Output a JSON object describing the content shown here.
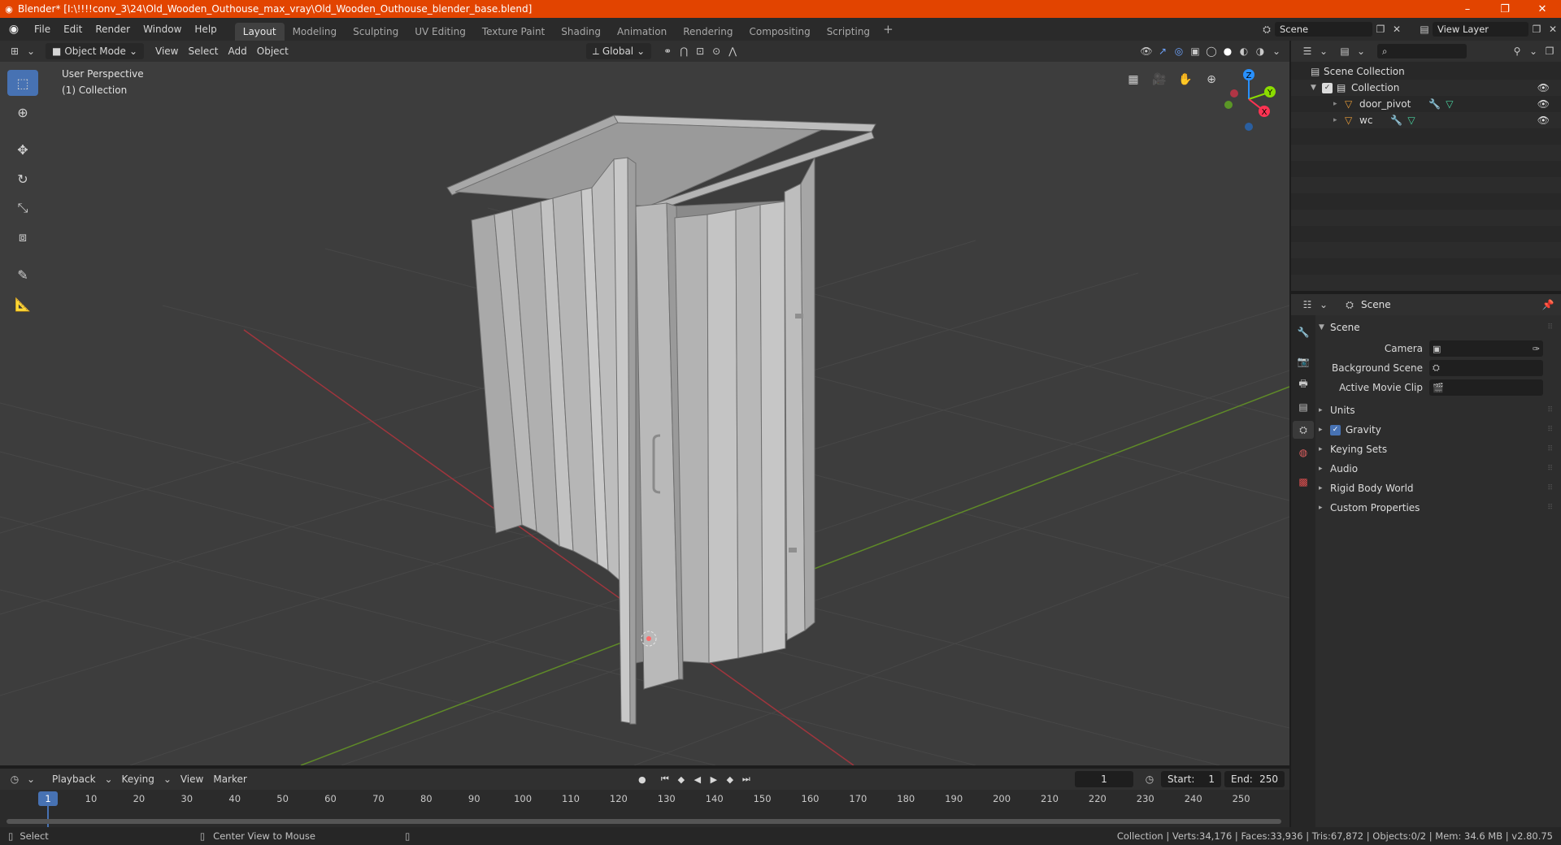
{
  "window": {
    "title": "Blender* [I:\\!!!!conv_3\\24\\Old_Wooden_Outhouse_max_vray\\Old_Wooden_Outhouse_blender_base.blend]",
    "minimize": "–",
    "maximize": "❐",
    "close": "✕"
  },
  "menu": [
    "File",
    "Edit",
    "Render",
    "Window",
    "Help"
  ],
  "workspaces": [
    "Layout",
    "Modeling",
    "Sculpting",
    "UV Editing",
    "Texture Paint",
    "Shading",
    "Animation",
    "Rendering",
    "Compositing",
    "Scripting"
  ],
  "workspace_add": "+",
  "scene_selector": "Scene",
  "view_layer": "View Layer",
  "viewport": {
    "mode": "Object Mode",
    "menus": [
      "View",
      "Select",
      "Add",
      "Object"
    ],
    "transform_orientation": "Global",
    "perspective_label": "User Perspective",
    "collection_label": "(1) Collection",
    "gizmo_axes": {
      "x": "X",
      "y": "Y",
      "z": "Z"
    }
  },
  "timeline": {
    "menus": [
      "Playback",
      "Keying",
      "View",
      "Marker"
    ],
    "current_frame": "1",
    "start_label": "Start:",
    "start": "1",
    "end_label": "End:",
    "end": "250",
    "ruler": [
      "1",
      "10",
      "20",
      "30",
      "40",
      "50",
      "60",
      "70",
      "80",
      "90",
      "100",
      "110",
      "120",
      "130",
      "140",
      "150",
      "160",
      "170",
      "180",
      "190",
      "200",
      "210",
      "220",
      "230",
      "240",
      "250"
    ]
  },
  "statusbar": {
    "select": "Select",
    "center_view": "Center View to Mouse",
    "stats": "Collection | Verts:34,176 | Faces:33,936 | Tris:67,872 | Objects:0/2 | Mem: 34.6 MB | v2.80.75"
  },
  "outliner": {
    "root": "Scene Collection",
    "collection": "Collection",
    "objects": [
      "door_pivot",
      "wc"
    ]
  },
  "properties": {
    "context": "Scene",
    "panel": "Scene",
    "camera_label": "Camera",
    "bg_scene_label": "Background Scene",
    "movie_clip_label": "Active Movie Clip",
    "subpanels": [
      "Units",
      "Gravity",
      "Keying Sets",
      "Audio",
      "Rigid Body World",
      "Custom Properties"
    ],
    "gravity_checked": true
  },
  "colors": {
    "titlebar": "#e24400",
    "accent": "#4772b3",
    "x_axis": "#ff3352",
    "y_axis": "#8bdc00",
    "z_axis": "#2890ff",
    "object_icon": "#e89c39"
  }
}
